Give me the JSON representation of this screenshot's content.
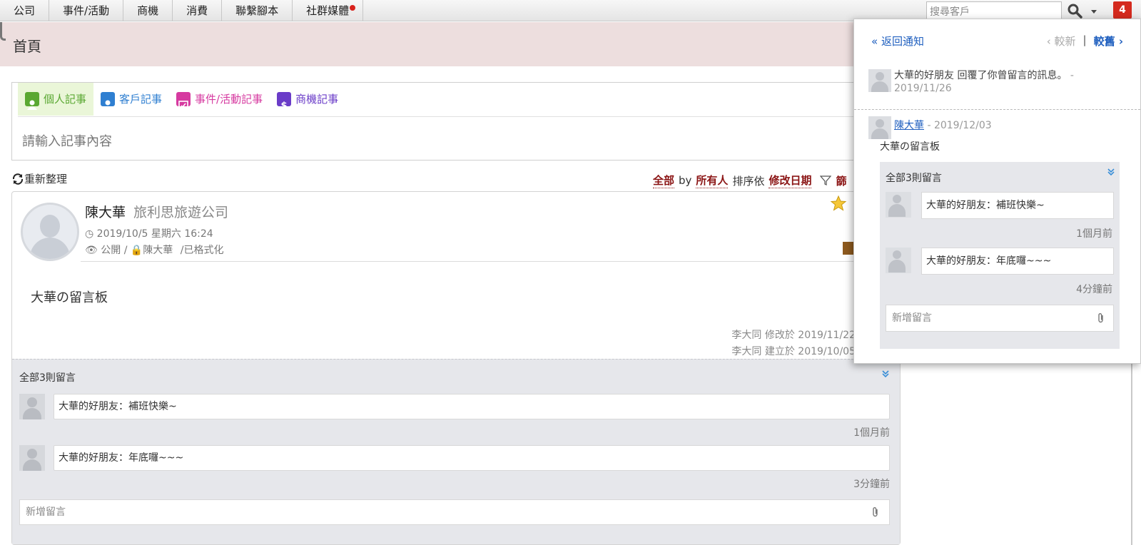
{
  "nav": {
    "items": [
      "公司",
      "事件/活動",
      "商機",
      "消費",
      "聯繫腳本",
      "社群媒體"
    ],
    "search_placeholder": "搜尋客戶",
    "notification_count": "4"
  },
  "header": {
    "title": "首頁"
  },
  "composer": {
    "tabs": [
      {
        "label": "個人記事",
        "color": "#5aa832"
      },
      {
        "label": "客戶記事",
        "color": "#2f7fd1"
      },
      {
        "label": "事件/活動記事",
        "color": "#d63aa0"
      },
      {
        "label": "商機記事",
        "color": "#6a3cc8"
      }
    ],
    "placeholder": "請輸入記事內容"
  },
  "toolbar": {
    "reorganize": "重新整理",
    "filter_all": "全部",
    "by": "by",
    "filter_owner": "所有人",
    "sort_by": "排序依",
    "sort_field": "修改日期",
    "filter_cut": "篩"
  },
  "post": {
    "author": "陳大華",
    "company": "旅利思旅遊公司",
    "datetime": "2019/10/5 星期六 16:24",
    "visibility": "公開",
    "owner": "陳大華",
    "format": "/已格式化",
    "body": "大華の留言板",
    "modified": "李大同 修改於 2019/11/22",
    "created": "李大同 建立於 2019/10/05",
    "comments_title": "全部3則留言",
    "comments": [
      {
        "text": "大華的好朋友：補班快樂~",
        "time": "1個月前"
      },
      {
        "text": "大華的好朋友：年底囉~~~",
        "time": "3分鐘前"
      }
    ],
    "new_comment_placeholder": "新增留言"
  },
  "popover": {
    "back": "« 返回通知",
    "older": "‹ 較新",
    "separator": "|",
    "newer": "較舊 ›",
    "notification_text": "大華的好朋友 回覆了你曾留言的訊息。",
    "notification_date": "- 2019/11/26",
    "user": "陳大華",
    "user_date": "- 2019/12/03",
    "body": "大華の留言板",
    "comments_title": "全部3則留言",
    "comments": [
      {
        "text": "大華的好朋友：補班快樂~",
        "time": "1個月前"
      },
      {
        "text": "大華的好朋友：年底囉~~~",
        "time": "4分鐘前"
      }
    ],
    "new_comment_placeholder": "新增留言"
  }
}
